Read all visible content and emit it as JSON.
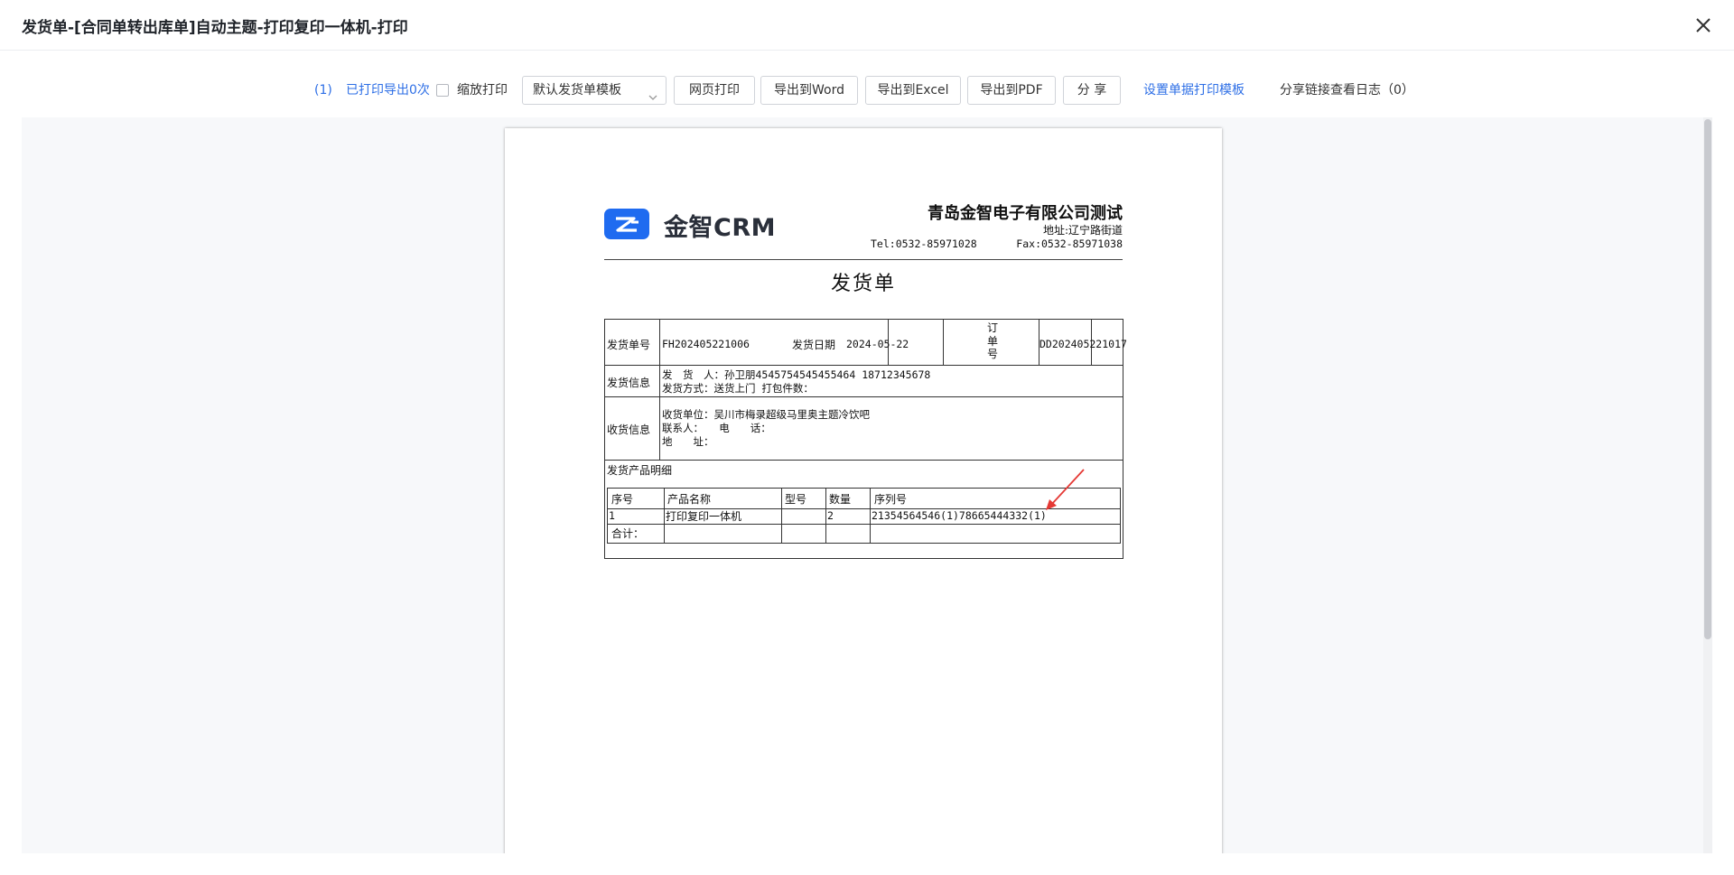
{
  "window": {
    "title": "发货单-[合同单转出库单]自动主题-打印复印一体机-打印"
  },
  "toolbar": {
    "print_count": "(1)",
    "exported_text": "已打印导出0次",
    "zoom_print_label": "缩放打印",
    "template_select": "默认发货单模板",
    "web_print": "网页打印",
    "export_word": "导出到Word",
    "export_excel": "导出到Excel",
    "export_pdf": "导出到PDF",
    "share": "分 享",
    "set_template": "设置单据打印模板",
    "share_log": "分享链接查看日志（0）"
  },
  "document": {
    "logo_text": "金智CRM",
    "company": "青岛金智电子有限公司测试",
    "address": "地址:辽宁路街道",
    "tel": "Tel:0532-85971028",
    "fax": "Fax:0532-85971038",
    "title": "发货单",
    "fields": {
      "order_no_label": "发货单号",
      "order_no": "FH202405221006",
      "date_label": "发货日期",
      "date": "2024-05-22",
      "sales_order_label": [
        "订",
        "单",
        "号"
      ],
      "sales_order": "DD202405221017",
      "ship_info_label": "发货信息",
      "shipper_line": "发　货　人：孙卫朋4545754545455464 18712345678",
      "ship_method_line": "发货方式：送货上门 打包件数：",
      "receive_info_label": "收货信息",
      "receiver_unit_line": "收货单位：吴川市梅录超级马里奥主题冷饮吧",
      "contact_line": "联系人：　　电　　话：",
      "address_line": "地　　址：",
      "detail_label": "发货产品明细"
    },
    "products": {
      "headers": [
        "序号",
        "产品名称",
        "型号",
        "数量",
        "序列号"
      ],
      "rows": [
        [
          "1",
          "打印复印一体机",
          "",
          "2",
          "21354564546(1)78665444332(1)"
        ]
      ],
      "total_label": "合计："
    }
  },
  "colors": {
    "link": "#2e6fe6",
    "logo_blue": "#1f6bf0",
    "annotation_arrow": "#e53935"
  }
}
